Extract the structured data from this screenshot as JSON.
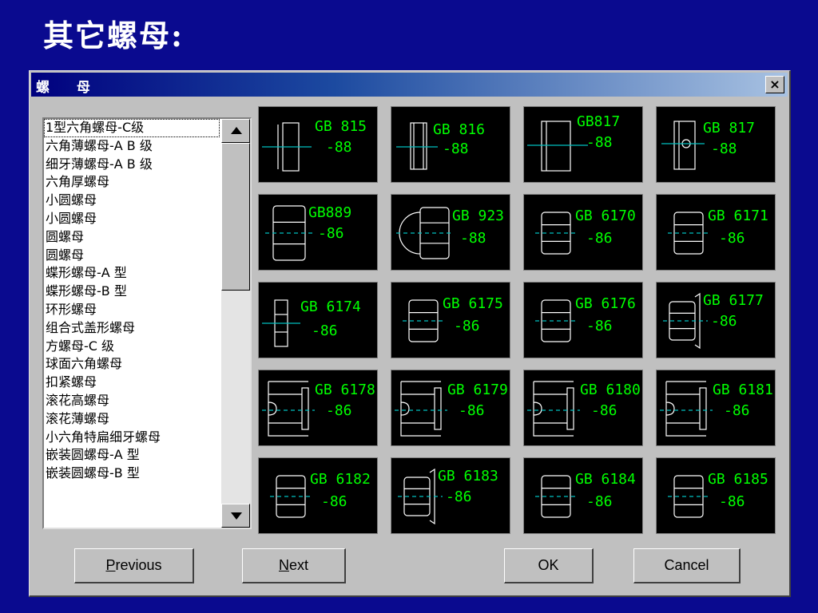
{
  "slide_title": "其它螺母:",
  "window": {
    "title": "螺 母",
    "close_glyph": "×"
  },
  "nut_list": {
    "items": [
      "1型六角螺母-C级",
      "六角薄螺母-A B 级",
      "细牙薄螺母-A B 级",
      "六角厚螺母",
      "小圆螺母",
      "小圆螺母",
      "圆螺母",
      "圆螺母",
      "蝶形螺母-A 型",
      "蝶形螺母-B 型",
      "环形螺母",
      "组合式盖形螺母",
      "方螺母-C 级",
      "球面六角螺母",
      "扣紧螺母",
      "滚花高螺母",
      "滚花薄螺母",
      "小六角特扁细牙螺母",
      "嵌装圆螺母-A 型",
      "嵌装圆螺母-B 型"
    ],
    "selected_index": 0
  },
  "tiles": [
    {
      "code": "GB 815",
      "year": "-88",
      "icon": "thin-hex-nut-side-icon"
    },
    {
      "code": "GB 816",
      "year": "-88",
      "icon": "fine-thin-nut-side-icon"
    },
    {
      "code": "GB817",
      "year": "-88",
      "icon": "thick-hex-nut-side-icon"
    },
    {
      "code": "GB 817",
      "year": "-88",
      "icon": "nut-with-hole-side-icon"
    },
    {
      "code": "GB889",
      "year": "-86",
      "icon": "slotted-round-nut-icon"
    },
    {
      "code": "GB 923",
      "year": "-88",
      "icon": "cap-nut-icon"
    },
    {
      "code": "GB 6170",
      "year": "-86",
      "icon": "hex-nut-profile-icon"
    },
    {
      "code": "GB 6171",
      "year": "-86",
      "icon": "hex-nut-profile-icon"
    },
    {
      "code": "GB 6174",
      "year": "-86",
      "icon": "thin-nut-profile-icon"
    },
    {
      "code": "GB 6175",
      "year": "-86",
      "icon": "hex-nut-profile-icon"
    },
    {
      "code": "GB 6176",
      "year": "-86",
      "icon": "hex-nut-profile-icon"
    },
    {
      "code": "GB 6177",
      "year": "-86",
      "icon": "flange-nut-icon"
    },
    {
      "code": "GB 6178",
      "year": "-86",
      "icon": "slotted-nut-icon"
    },
    {
      "code": "GB 6179",
      "year": "-86",
      "icon": "slotted-nut-icon"
    },
    {
      "code": "GB 6180",
      "year": "-86",
      "icon": "slotted-nut-icon"
    },
    {
      "code": "GB 6181",
      "year": "-86",
      "icon": "slotted-nut-icon"
    },
    {
      "code": "GB 6182",
      "year": "-86",
      "icon": "hex-nut-profile-icon"
    },
    {
      "code": "GB 6183",
      "year": "-86",
      "icon": "flange-nut-icon"
    },
    {
      "code": "GB 6184",
      "year": "-86",
      "icon": "hex-nut-profile-icon"
    },
    {
      "code": "GB 6185",
      "year": "-86",
      "icon": "hex-nut-profile-icon"
    }
  ],
  "buttons": {
    "previous": {
      "mnemonic": "P",
      "rest": "revious"
    },
    "next": {
      "mnemonic": "N",
      "rest": "ext"
    },
    "ok": "OK",
    "cancel": "Cancel"
  },
  "colors": {
    "background": "#0a0a8f",
    "titlebar_start": "#00007f",
    "titlebar_end": "#a8c2e2",
    "label_text": "#00ff00",
    "centerline": "#00c0c0",
    "drawing_lines": "#ffffff"
  }
}
